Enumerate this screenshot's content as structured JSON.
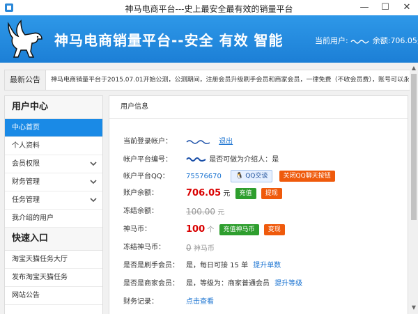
{
  "window": {
    "title": "神马电商平台---史上最安全最有效的销量平台",
    "min": "—",
    "max": "☐",
    "close": "✕"
  },
  "header": {
    "site_title": "神马电商销量平台--安全 有效 智能",
    "user_label": "当前用户:",
    "balance_label": " 余额:",
    "balance_value": "706.05元"
  },
  "notice": {
    "label": "最新公告",
    "text": "神马电商销量平台于2015.07.01开始公测，公测期间，注册会员升级刷手会员和商家会员，一律免费（不收会员费），账号可以永久免费使用！"
  },
  "sidebar": {
    "user_center_title": "用户中心",
    "items": [
      {
        "label": "中心首页",
        "active": true,
        "chevron": false
      },
      {
        "label": "个人资料",
        "active": false,
        "chevron": false
      },
      {
        "label": "会员权限",
        "active": false,
        "chevron": true
      },
      {
        "label": "财务管理",
        "active": false,
        "chevron": true
      },
      {
        "label": "任务管理",
        "active": false,
        "chevron": true
      },
      {
        "label": "我介绍的用户",
        "active": false,
        "chevron": false
      }
    ],
    "quick_title": "快速入口",
    "quick_items": [
      {
        "label": "淘宝天猫任务大厅"
      },
      {
        "label": "发布淘宝天猫任务"
      },
      {
        "label": "网站公告"
      }
    ]
  },
  "main": {
    "title": "用户信息",
    "login_label": "当前登录帐户：",
    "logout": "退出",
    "id_label": "帐户平台编号：",
    "referrer_question": "是否可做为介绍人：",
    "referrer_value": "是",
    "qq_label": "帐户平台QQ：",
    "qq_value": "75576670",
    "qq_chat": "QQ交谈",
    "qq_close": "关闭QQ聊天按钮",
    "balance_label": "账户余额：",
    "balance_value": "706.05",
    "balance_unit": "元",
    "recharge": "充值",
    "withdraw": "提现",
    "frozen_label": "冻结余额：",
    "frozen_value": "100.00",
    "frozen_unit": "元",
    "coin_label": "神马币：",
    "coin_value": "100",
    "coin_unit": "个",
    "coin_recharge": "充值神马币",
    "coin_exchange": "变现",
    "frozen_coin_label": "冻结神马币：",
    "frozen_coin_value": "0",
    "frozen_coin_unit": "神马币",
    "brusher_label": "是否是刷手会员：",
    "brusher_value": "是，每日可接 15 单",
    "brusher_upgrade": "提升单数",
    "merchant_label": "是否是商家会员：",
    "merchant_value": "是，等级为：商家普通会员",
    "merchant_upgrade": "提升等级",
    "finance_label": "财务记录：",
    "finance_link": "点击查看"
  },
  "colors": {
    "header": "#1c7fd6",
    "active": "#1a8ae6",
    "green": "#2e9e2e",
    "orange": "#ef5a0c",
    "red": "#d90000"
  }
}
